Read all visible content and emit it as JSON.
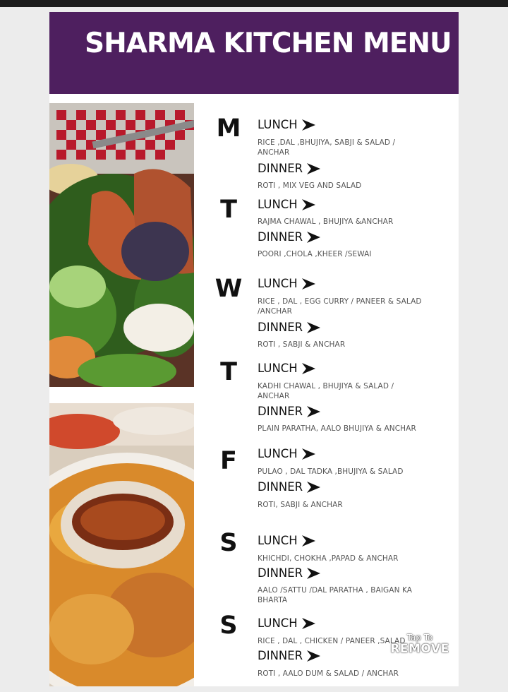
{
  "title": "SHARMA KITCHEN  MENU",
  "lunch_label": "LUNCH",
  "dinner_label": "DINNER",
  "days": [
    {
      "letter": "M",
      "lunch": "RICE ,DAL ,BHUJIYA, SABJI & SALAD / ANCHAR",
      "dinner": "ROTI , MIX VEG AND SALAD"
    },
    {
      "letter": "T",
      "lunch": "RAJMA CHAWAL , BHUJIYA  &ANCHAR",
      "dinner": "POORI ,CHOLA ,KHEER /SEWAI"
    },
    {
      "letter": "W",
      "lunch": "RICE , DAL , EGG CURRY / PANEER & SALAD /ANCHAR",
      "dinner": "ROTI , SABJI & ANCHAR"
    },
    {
      "letter": "T",
      "lunch": "KADHI CHAWAL , BHUJIYA  & SALAD / ANCHAR",
      "dinner": "PLAIN PARATHA, AALO BHUJIYA  & ANCHAR"
    },
    {
      "letter": "F",
      "lunch": "PULAO , DAL TADKA ,BHUJIYA & SALAD",
      "dinner": "ROTI, SABJI & ANCHAR"
    },
    {
      "letter": "S",
      "lunch": "KHICHDI, CHOKHA ,PAPAD & ANCHAR",
      "dinner": "AALO /SATTU /DAL PARATHA , BAIGAN KA BHARTA"
    },
    {
      "letter": "S",
      "lunch": "RICE , DAL , CHICKEN / PANEER ,SALAD",
      "dinner": "ROTI , AALO DUM & SALAD / ANCHAR"
    }
  ],
  "watermark": {
    "line1": "Tap To",
    "line2": "REMOVE"
  },
  "colors": {
    "banner": "#4e1f5f",
    "text": "#111111",
    "items_text": "#555555"
  }
}
